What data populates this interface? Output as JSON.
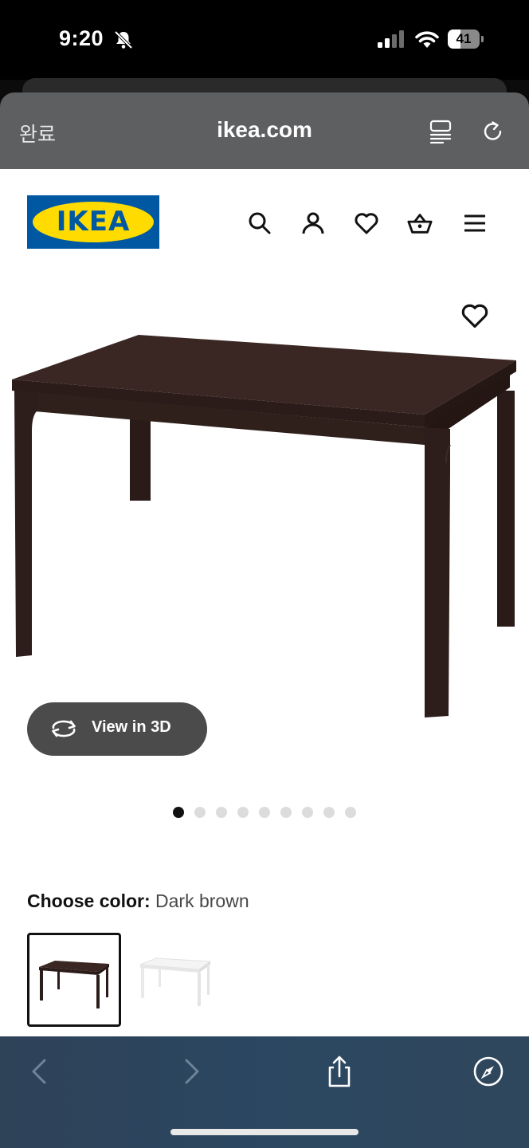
{
  "status_bar": {
    "time": "9:20",
    "battery_level": "41",
    "battery_fraction": 0.41,
    "icons": [
      "bell-slash-icon",
      "cellular-signal-icon",
      "wifi-icon",
      "battery-icon"
    ]
  },
  "browser": {
    "done_label": "완료",
    "url": "ikea.com",
    "icons": [
      "reader-mode-icon",
      "reload-icon"
    ]
  },
  "site": {
    "logo_text": "IKEA",
    "nav_icons": [
      "search-icon",
      "account-icon",
      "heart-icon",
      "shopping-basket-icon",
      "menu-icon"
    ]
  },
  "product": {
    "favorite_icon": "heart-icon",
    "view_3d_label": "View in 3D",
    "image_dots_total": 9,
    "image_dots_active": 1,
    "color_label": "Choose color:",
    "color_value": "Dark brown",
    "swatches": [
      {
        "name": "dark-brown",
        "selected": true
      },
      {
        "name": "white",
        "selected": false
      }
    ]
  },
  "toolbar": {
    "icons": [
      "back-chevron-icon",
      "forward-chevron-icon",
      "share-icon",
      "compass-icon"
    ]
  },
  "colors": {
    "ikea_blue": "#0058a3",
    "ikea_yellow": "#ffdb00",
    "table_dark_brown": "#2e1f1c",
    "browser_header": "#5e5f61",
    "toolbar_blue": "#2b4761"
  }
}
